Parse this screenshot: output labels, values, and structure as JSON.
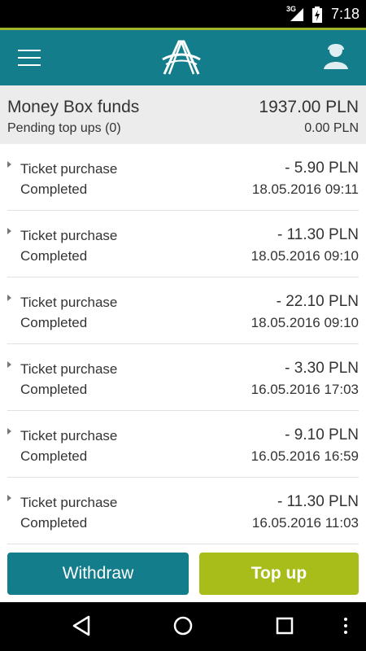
{
  "status_bar": {
    "network": "3G",
    "time": "7:18"
  },
  "app_bar": {
    "menu_icon": "hamburger-menu-icon",
    "logo_icon": "app-logo-icon",
    "account_icon": "account-icon"
  },
  "summary": {
    "title": "Money Box funds",
    "total": "1937.00 PLN",
    "pending_label": "Pending top ups (0)",
    "pending_value": "0.00 PLN"
  },
  "transactions": [
    {
      "type": "Ticket purchase",
      "amount": "- 5.90 PLN",
      "status": "Completed",
      "date": "18.05.2016 09:11"
    },
    {
      "type": "Ticket purchase",
      "amount": "- 11.30 PLN",
      "status": "Completed",
      "date": "18.05.2016 09:10"
    },
    {
      "type": "Ticket purchase",
      "amount": "- 22.10 PLN",
      "status": "Completed",
      "date": "18.05.2016 09:10"
    },
    {
      "type": "Ticket purchase",
      "amount": "- 3.30 PLN",
      "status": "Completed",
      "date": "16.05.2016 17:03"
    },
    {
      "type": "Ticket purchase",
      "amount": "- 9.10 PLN",
      "status": "Completed",
      "date": "16.05.2016 16:59"
    },
    {
      "type": "Ticket purchase",
      "amount": "- 11.30 PLN",
      "status": "Completed",
      "date": "16.05.2016 11:03"
    }
  ],
  "actions": {
    "withdraw_label": "Withdraw",
    "topup_label": "Top up"
  },
  "colors": {
    "primary": "#137d8b",
    "accent": "#a8bd19"
  }
}
